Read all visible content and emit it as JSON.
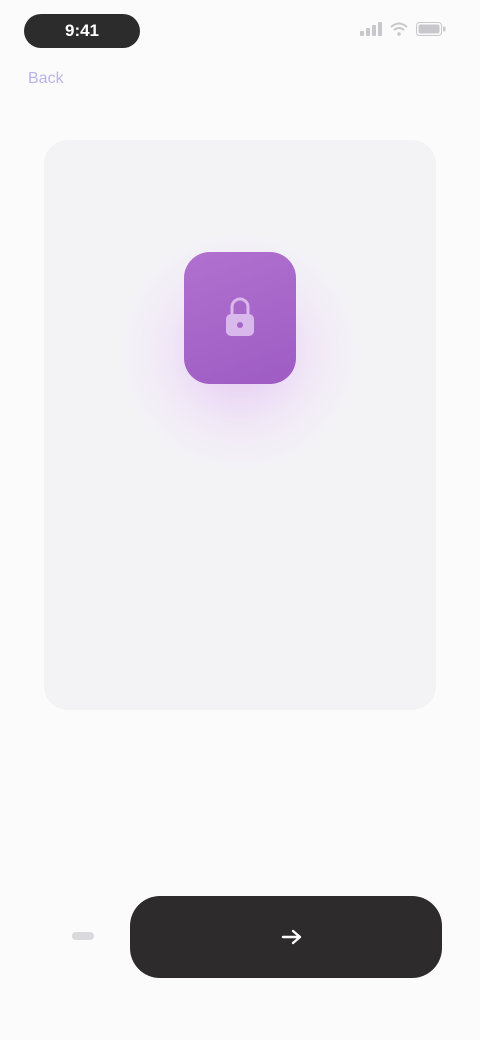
{
  "status_bar": {
    "time": "9:41",
    "icons": [
      "signal-icon",
      "wifi-icon",
      "battery-icon"
    ]
  },
  "nav": {
    "back_label": "Back"
  },
  "card": {
    "icon": "app-icon",
    "title": "",
    "subtitle": ""
  },
  "description": "",
  "primary_button": {
    "label": "",
    "icon": "arrow-right-icon"
  },
  "colors": {
    "accent": "#a566c8",
    "button": "#2d2b2c",
    "background": "#fbfbfc"
  }
}
